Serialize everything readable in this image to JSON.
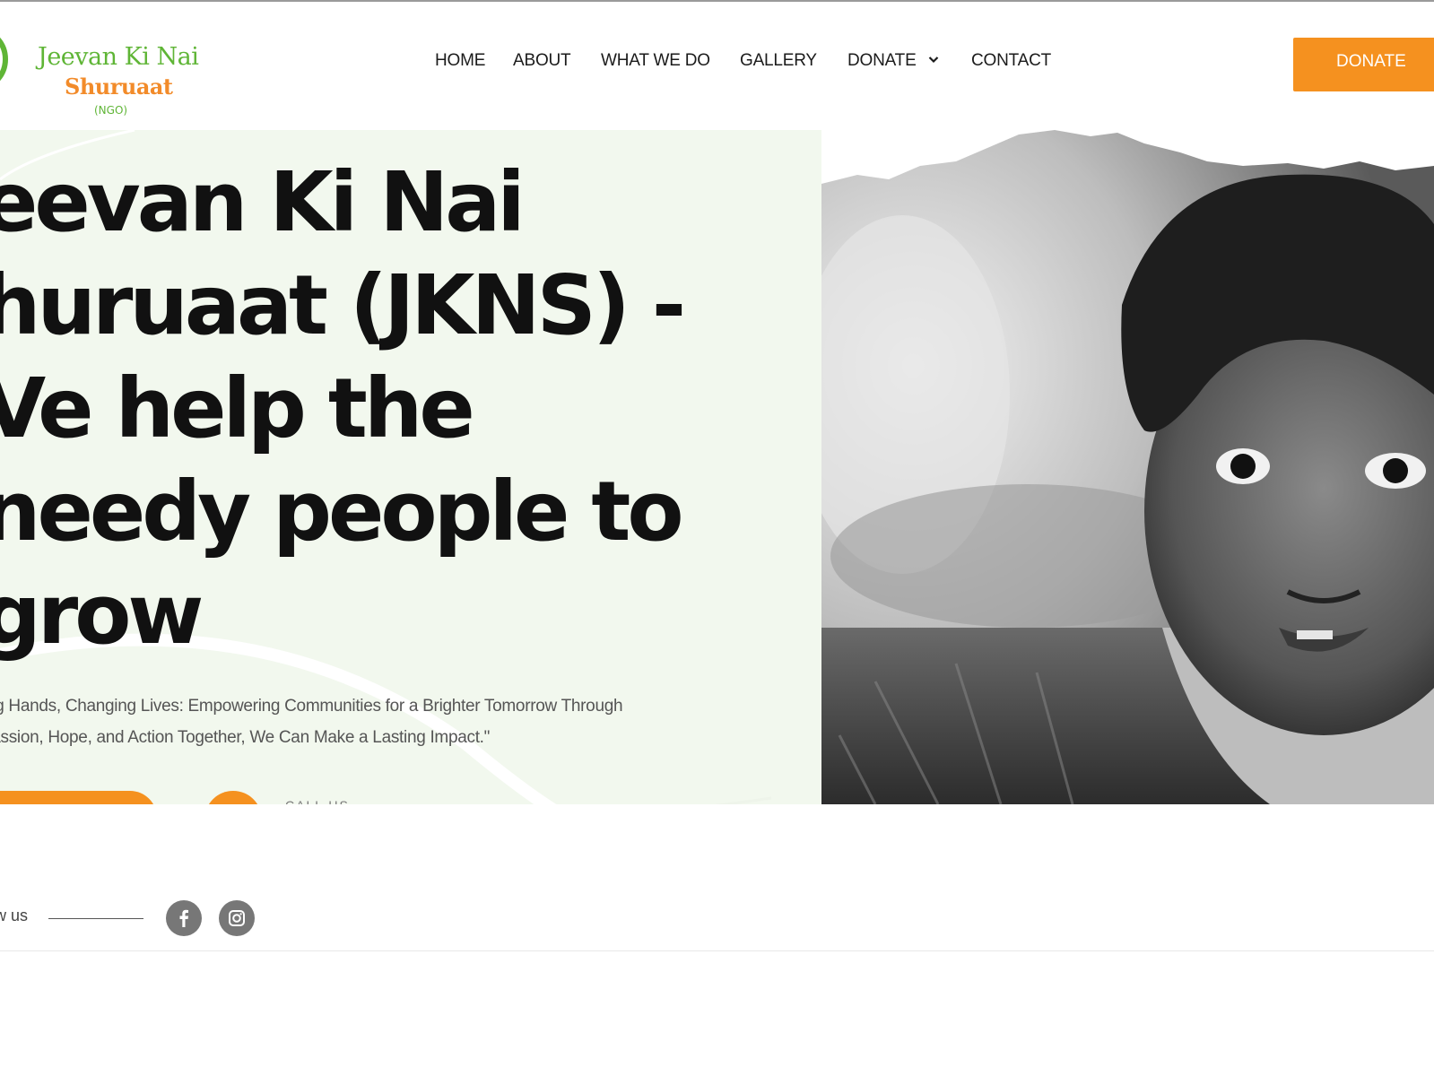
{
  "logo": {
    "line1": "Jeevan Ki Nai",
    "line2": "Shuruaat",
    "line3": "(NGO)"
  },
  "nav": {
    "items": [
      "HOME",
      "ABOUT",
      "WHAT WE DO",
      "GALLERY",
      "DONATE",
      "CONTACT"
    ],
    "donate_dropdown_icon": "chevron-down-icon"
  },
  "header": {
    "donate_button": "DONATE"
  },
  "hero": {
    "title_lines": [
      "eevan Ki Nai",
      "huruaat (JKNS) -",
      "Ve help the",
      "needy people to",
      "grow"
    ],
    "subtitle_lines": [
      "ing Hands, Changing Lives: Empowering Communities for a Brighter Tomorrow Through",
      "passion, Hope, and Action Together, We Can Make a Lasting Impact.\""
    ],
    "call_label": "CALL US"
  },
  "follow": {
    "label": "w us",
    "icons": [
      "facebook-icon",
      "instagram-icon"
    ]
  },
  "colors": {
    "accent_orange": "#f5911f",
    "logo_green": "#5fb536",
    "logo_orange": "#f28b2a",
    "hero_bg": "#f2f8ee",
    "social_gray": "#777777"
  }
}
